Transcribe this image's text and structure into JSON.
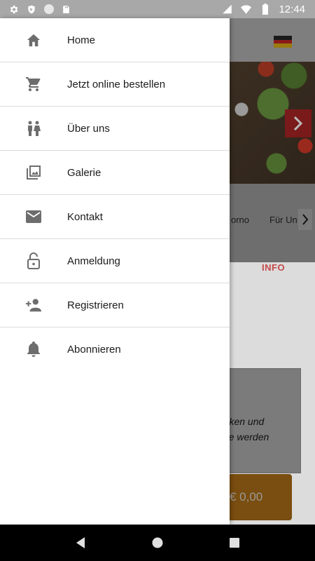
{
  "status_bar": {
    "time": "12:44",
    "left_icons": [
      "settings-icon",
      "shield-icon",
      "circle-icon",
      "sd-card-icon"
    ],
    "right_icons": [
      "cell-signal-icon",
      "wifi-icon",
      "battery-icon"
    ]
  },
  "drawer": {
    "items": [
      {
        "label": "Home",
        "icon": "home-icon"
      },
      {
        "label": "Jetzt online bestellen",
        "icon": "shopping-cart-icon"
      },
      {
        "label": "Über uns",
        "icon": "people-icon"
      },
      {
        "label": "Galerie",
        "icon": "photo-gallery-icon"
      },
      {
        "label": "Kontakt",
        "icon": "mail-icon"
      },
      {
        "label": "Anmeldung",
        "icon": "lock-open-icon"
      },
      {
        "label": "Registrieren",
        "icon": "person-add-icon"
      },
      {
        "label": "Abonnieren",
        "icon": "bell-icon"
      }
    ]
  },
  "background": {
    "categories": [
      "orno",
      "Für Un"
    ],
    "info_tab": "INFO",
    "card_text_line1": "urken und",
    "card_text_line2": "nte werden",
    "price_button": "€ 0,00",
    "flag_colors": [
      "#1a1a1a",
      "#8a1a1a",
      "#9a7a10"
    ]
  },
  "nav_bar": {
    "buttons": [
      "back-icon",
      "home-circle-icon",
      "recents-icon"
    ]
  }
}
